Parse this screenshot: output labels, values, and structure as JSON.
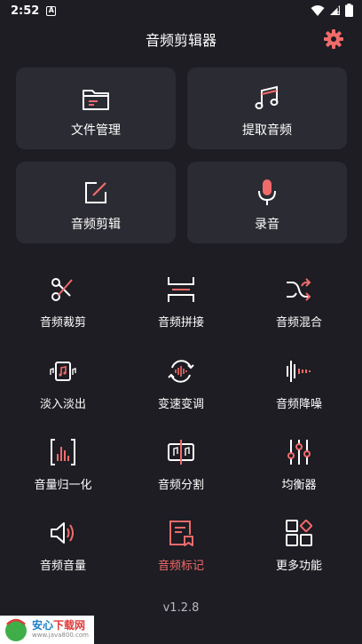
{
  "status": {
    "time": "2:52",
    "notification_glyph": "A"
  },
  "header": {
    "title": "音频剪辑器"
  },
  "cards": [
    {
      "label": "文件管理",
      "icon": "folder-icon"
    },
    {
      "label": "提取音频",
      "icon": "music-note-icon"
    },
    {
      "label": "音频剪辑",
      "icon": "edit-icon"
    },
    {
      "label": "录音",
      "icon": "microphone-icon"
    }
  ],
  "tools": [
    {
      "label": "音频裁剪",
      "icon": "scissors-icon"
    },
    {
      "label": "音频拼接",
      "icon": "join-icon"
    },
    {
      "label": "音频混合",
      "icon": "shuffle-icon"
    },
    {
      "label": "淡入淡出",
      "icon": "fade-icon"
    },
    {
      "label": "变速变调",
      "icon": "speed-icon"
    },
    {
      "label": "音频降噪",
      "icon": "noise-reduce-icon"
    },
    {
      "label": "音量归一化",
      "icon": "normalize-icon"
    },
    {
      "label": "音频分割",
      "icon": "split-icon"
    },
    {
      "label": "均衡器",
      "icon": "equalizer-icon"
    },
    {
      "label": "音频音量",
      "icon": "volume-icon"
    },
    {
      "label": "音频标记",
      "icon": "bookmark-icon"
    },
    {
      "label": "更多功能",
      "icon": "more-grid-icon"
    }
  ],
  "footer": {
    "version": "v1.2.8"
  },
  "watermark": {
    "brand_a": "安心",
    "brand_b": "下载网",
    "url": "www.java800.com",
    "logo_text": "精品软件"
  },
  "colors": {
    "background": "#1d1d23",
    "card": "#2b2b33",
    "accent": "#f26b6b",
    "icon": "#ffffff"
  }
}
